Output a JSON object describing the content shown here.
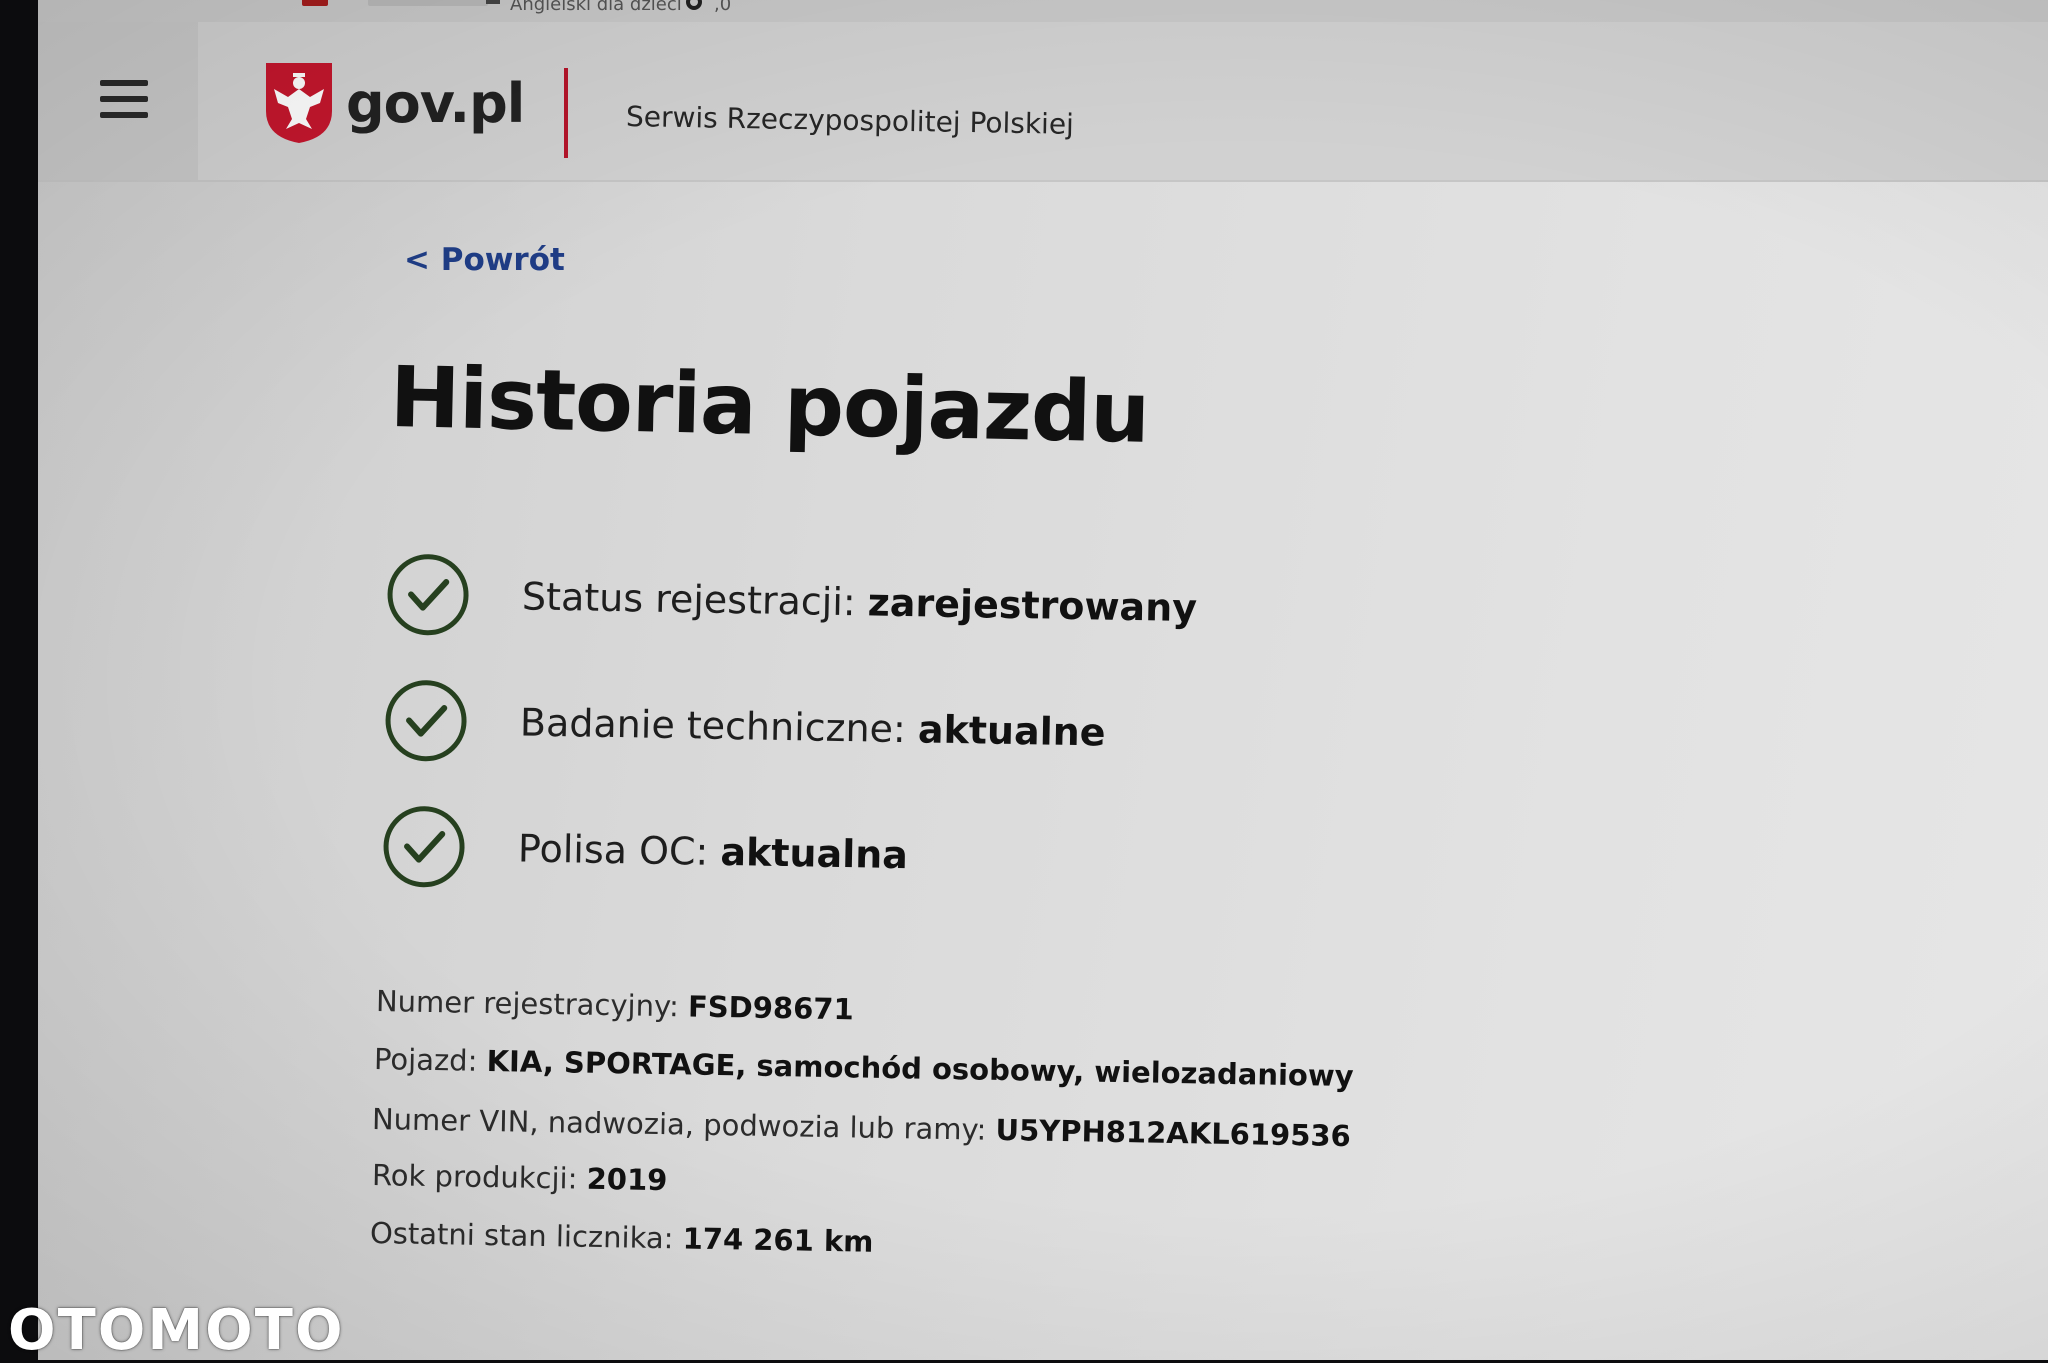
{
  "bookmarks": {
    "items": [
      "Angielski dla dzieci",
      ",0"
    ]
  },
  "header": {
    "logo_text": "gov.pl",
    "service_name": "Serwis Rzeczypospolitej Polskiej"
  },
  "nav": {
    "back_label": "< Powrót"
  },
  "page": {
    "title": "Historia pojazdu"
  },
  "statuses": [
    {
      "label": "Status rejestracji:",
      "value": "zarejestrowany"
    },
    {
      "label": "Badanie techniczne:",
      "value": "aktualne"
    },
    {
      "label": "Polisa OC:",
      "value": "aktualna"
    }
  ],
  "details": [
    {
      "label": "Numer rejestracyjny:",
      "value": "FSD98671"
    },
    {
      "label": "Pojazd:",
      "value": "KIA, SPORTAGE, samochód osobowy, wielozadaniowy"
    },
    {
      "label": "Numer VIN, nadwozia, podwozia lub ramy:",
      "value": "U5YPH812AKL619536"
    },
    {
      "label": "Rok produkcji:",
      "value": "2019"
    },
    {
      "label": "Ostatni stan licznika:",
      "value": "174 261 km"
    }
  ],
  "watermark": "OTOMOTO",
  "colors": {
    "brand_red": "#b5142a",
    "link_blue": "#1f3d86",
    "check_green": "#26401f"
  },
  "icons": {
    "menu": "hamburger-icon",
    "emblem": "polish-eagle-emblem",
    "status": "check-circle-icon"
  }
}
